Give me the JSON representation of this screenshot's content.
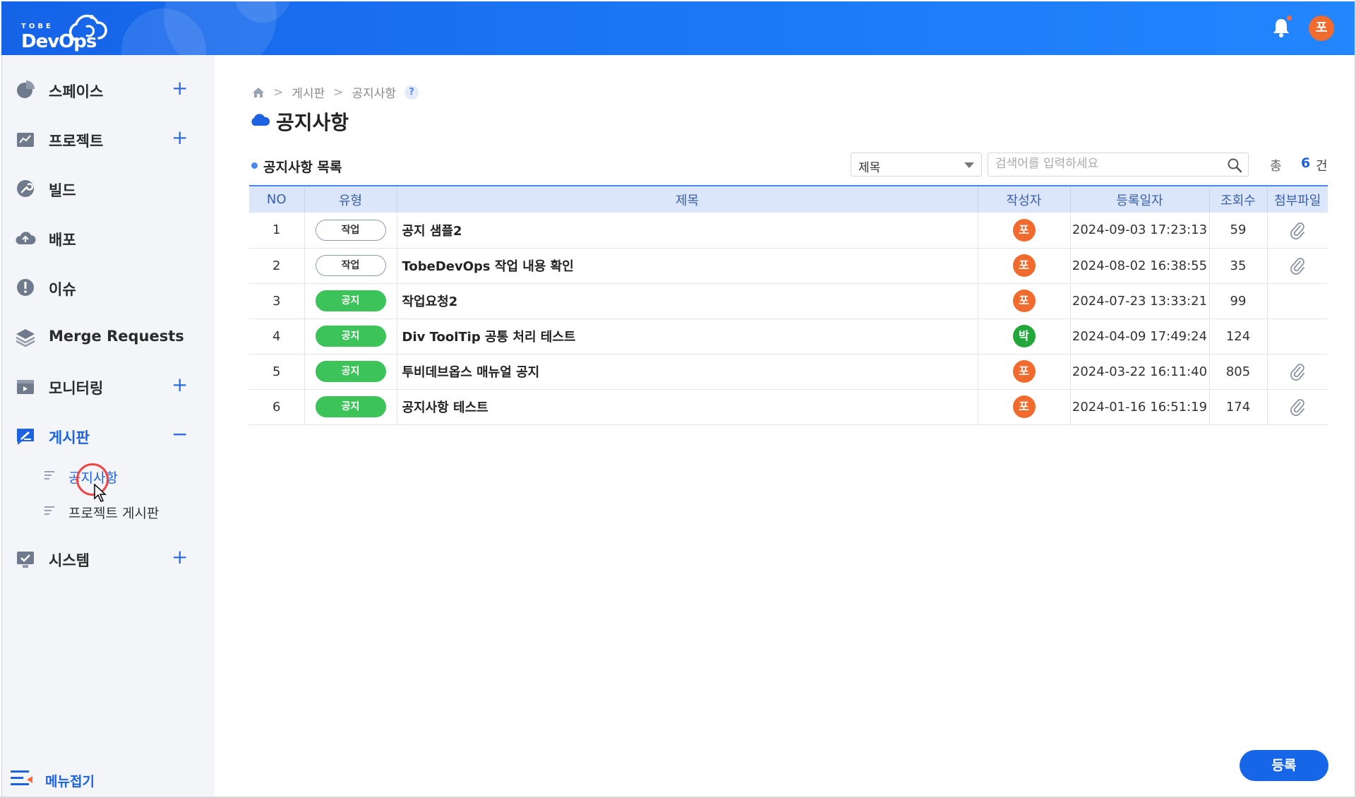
{
  "header": {
    "logo_small": "TOBE",
    "logo_main": "DevOps",
    "user_avatar": "포",
    "brand_color": "#1a74f2"
  },
  "sidebar": {
    "items": [
      {
        "label": "스페이스",
        "icon": "pie-chart-icon",
        "expand": "+"
      },
      {
        "label": "프로젝트",
        "icon": "project-board-icon",
        "expand": "+"
      },
      {
        "label": "빌드",
        "icon": "wrench-icon"
      },
      {
        "label": "배포",
        "icon": "cloud-upload-icon"
      },
      {
        "label": "이슈",
        "icon": "alert-icon"
      },
      {
        "label": "Merge Requests",
        "icon": "layers-icon"
      },
      {
        "label": "모니터링",
        "icon": "monitor-icon",
        "expand": "+"
      },
      {
        "label": "게시판",
        "icon": "edit-board-icon",
        "expand": "−"
      },
      {
        "label": "시스템",
        "icon": "system-check-icon",
        "expand": "+"
      }
    ],
    "sub_items": [
      {
        "label": "공지사항"
      },
      {
        "label": "프로젝트 게시판"
      }
    ],
    "collapse_label": "메뉴접기"
  },
  "main": {
    "breadcrumb": [
      "게시판",
      "공지사항"
    ],
    "help": "?",
    "title": "공지사항",
    "list_title": "공지사항 목록",
    "search": {
      "field": "제목",
      "placeholder": "검색어를 입력하세요"
    },
    "total_label": "총",
    "total_count": "6",
    "total_unit": "건",
    "register_label": "등록"
  },
  "table": {
    "columns": [
      "NO",
      "유형",
      "제목",
      "작성자",
      "등록일자",
      "조회수",
      "첨부파일"
    ],
    "rows": [
      {
        "no": "1",
        "type": "작업",
        "title": "공지 샘플2",
        "author": "포",
        "date": "2024-09-03 17:23:13",
        "views": "59",
        "attach": true
      },
      {
        "no": "2",
        "type": "작업",
        "title": "TobeDevOps 작업 내용 확인",
        "author": "포",
        "date": "2024-08-02 16:38:55",
        "views": "35",
        "attach": true
      },
      {
        "no": "3",
        "type": "공지",
        "title": "작업요청2",
        "author": "포",
        "date": "2024-07-23 13:33:21",
        "views": "99",
        "attach": false
      },
      {
        "no": "4",
        "type": "공지",
        "title": "Div ToolTip 공통 처리 테스트",
        "author": "박",
        "date": "2024-04-09 17:49:24",
        "views": "124",
        "attach": false
      },
      {
        "no": "5",
        "type": "공지",
        "title": "투비데브옵스 매뉴얼 공지",
        "author": "포",
        "date": "2024-03-22 16:11:40",
        "views": "805",
        "attach": true
      },
      {
        "no": "6",
        "type": "공지",
        "title": "공지사항 테스트",
        "author": "포",
        "date": "2024-01-16 16:51:19",
        "views": "174",
        "attach": true
      }
    ],
    "author_colors": {
      "포": "#f26b2e",
      "박": "#22a83a"
    }
  }
}
